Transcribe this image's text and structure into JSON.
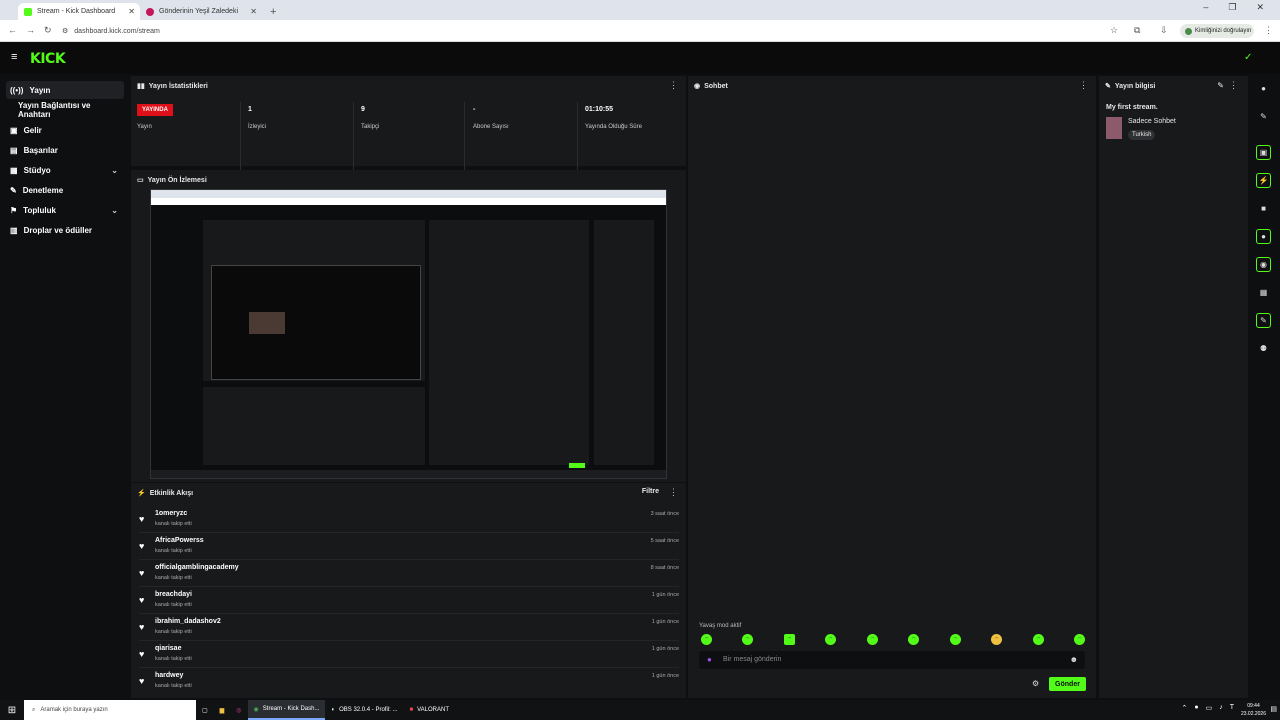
{
  "browser": {
    "tabs": [
      {
        "label": "Stream - Kick Dashboard",
        "active": true
      },
      {
        "label": "Gönderinin Yeşil Zaledeki",
        "active": false
      }
    ],
    "url": "dashboard.kick.com/stream",
    "profile": "Kimliğinizi doğrulayın"
  },
  "colors": {
    "accent": "#53fc18",
    "live": "#e0101a"
  },
  "sidebar": {
    "items": [
      {
        "label": "Yayın",
        "icon": "broadcast-icon",
        "active": true
      },
      {
        "label": "Yayın Bağlantısı ve Anahtarı",
        "icon": "",
        "active": false
      },
      {
        "label": "Gelir",
        "icon": "wallet-icon",
        "active": false
      },
      {
        "label": "Başarılar",
        "icon": "trophy-icon",
        "active": false
      },
      {
        "label": "Stüdyo",
        "icon": "studio-icon",
        "active": false,
        "expandable": true
      },
      {
        "label": "Denetleme",
        "icon": "wrench-icon",
        "active": false
      },
      {
        "label": "Topluluk",
        "icon": "community-icon",
        "active": false,
        "expandable": true
      },
      {
        "label": "Droplar ve ödüller",
        "icon": "gift-icon",
        "active": false
      }
    ]
  },
  "stats": {
    "title": "Yayın İstatistikleri",
    "live_badge": "YAYINDA",
    "live_label": "Yayın",
    "items": [
      {
        "value": "1",
        "label": "İzleyici"
      },
      {
        "value": "9",
        "label": "Takipçi"
      },
      {
        "value": "-",
        "label": "Abone Sayısı"
      },
      {
        "value": "01:10:55",
        "label": "Yayında Olduğu Süre"
      }
    ]
  },
  "preview": {
    "title": "Yayın Ön İzlemesi"
  },
  "feed": {
    "title": "Etkinlik Akışı",
    "filter": "Filtre",
    "rows": [
      {
        "user": "1omeryzc",
        "action": "kanalı takip etti",
        "time": "3 saat önce"
      },
      {
        "user": "AfricaPowerss",
        "action": "kanalı takip etti",
        "time": "5 saat önce"
      },
      {
        "user": "officialgamblingacademy",
        "action": "kanalı takip etti",
        "time": "8 saat önce"
      },
      {
        "user": "breachdayi",
        "action": "kanalı takip etti",
        "time": "1 gün önce"
      },
      {
        "user": "ibrahim_dadashov2",
        "action": "kanalı takip etti",
        "time": "1 gün önce"
      },
      {
        "user": "qiarisae",
        "action": "kanalı takip etti",
        "time": "1 gün önce"
      },
      {
        "user": "hardwey",
        "action": "kanalı takip etti",
        "time": "1 gün önce"
      }
    ]
  },
  "chat": {
    "title": "Sohbet",
    "slow_mode": "Yavaş mod aktif",
    "placeholder": "Bir mesaj gönderin",
    "send": "Gönder"
  },
  "info": {
    "title": "Yayın bilgisi",
    "stream_title": "My first stream.",
    "category": "Sadece Sohbet",
    "language": "Turkish"
  },
  "taskbar": {
    "search": "Aramak için buraya yazın",
    "apps": [
      "Stream - Kick Dash...",
      "OBS 32.0.4 - Profil: ...",
      "VALORANT"
    ],
    "time": "09:44",
    "date": "23.02.2026"
  }
}
